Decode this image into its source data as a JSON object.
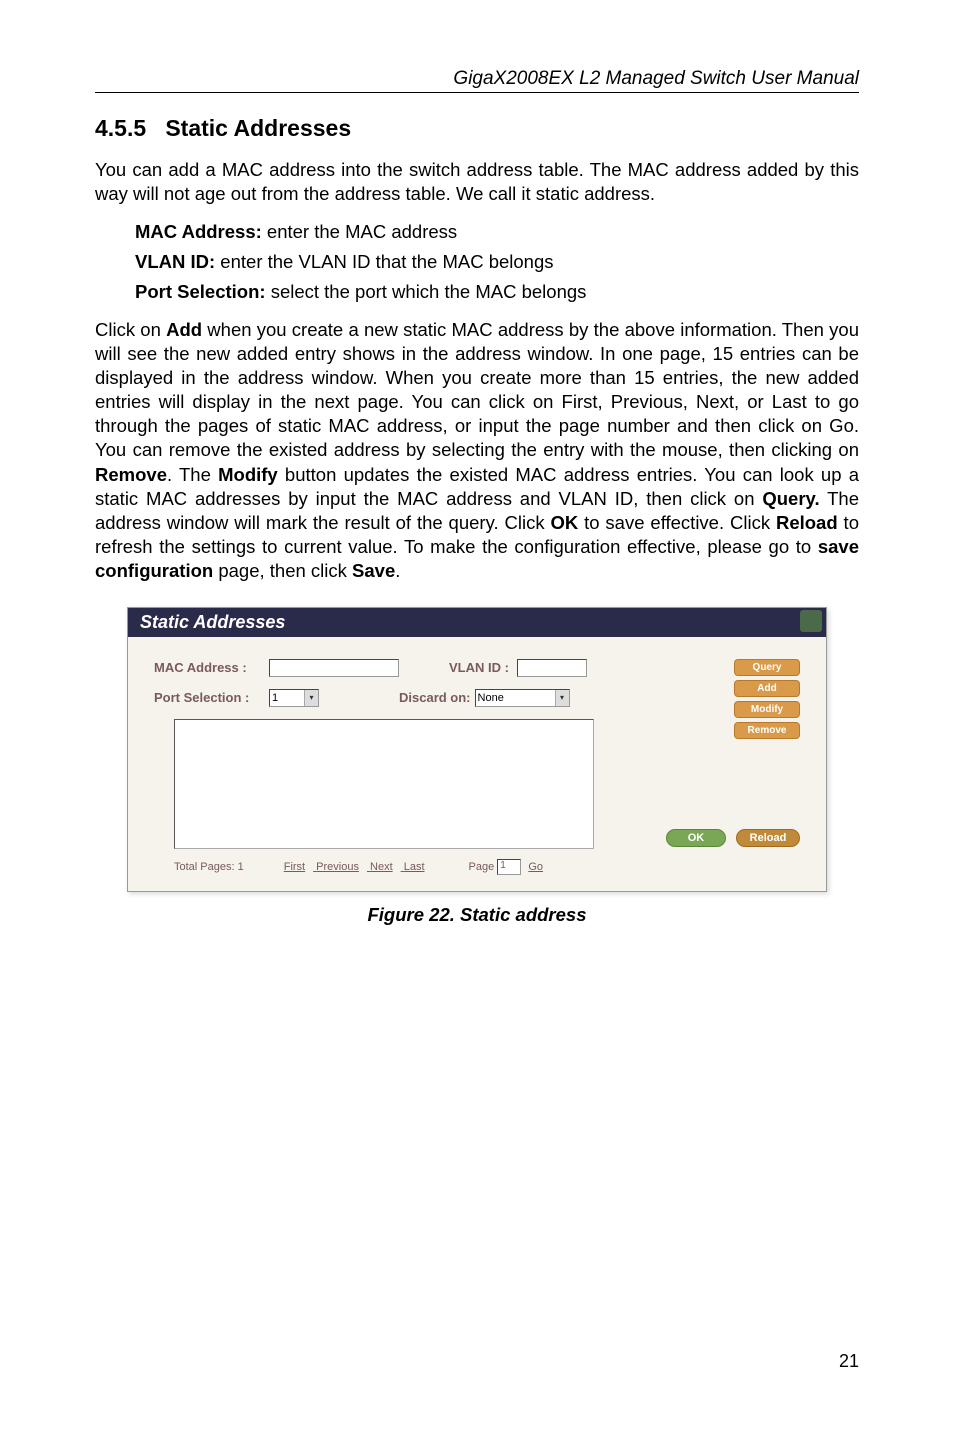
{
  "header": {
    "title": "GigaX2008EX L2 Managed Switch User Manual"
  },
  "section": {
    "number": "4.5.5",
    "title": "Static Addresses"
  },
  "para1": "You can add a MAC address into the switch address table. The MAC address added by this way will not age out from the address table. We call it static address.",
  "bullets": {
    "b1_label": "MAC Address:",
    "b1_text": " enter the MAC address",
    "b2_label": "VLAN ID:",
    "b2_text": " enter the VLAN ID that the MAC belongs",
    "b3_label": "Port Selection:",
    "b3_text": " select the port which the MAC belongs"
  },
  "para2_parts": {
    "p1": "Click on ",
    "b1": "Add",
    "p2": " when you create a new static MAC address by the above information. Then you will see the new added entry shows in the address window. In one page, 15 entries can be displayed in the address window. When you create more than 15 entries, the new added entries will display in the next page. You can click on First, Previous, Next, or Last to go through the pages of static MAC address, or input the page number and then click on Go. You can remove the existed address by selecting the entry with the mouse, then clicking on ",
    "b2": "Remove",
    "p3": ". The ",
    "b3": "Modify",
    "p4": " button updates the existed MAC address entries. You can look up a static MAC addresses by input the MAC address and VLAN ID, then click on ",
    "b4": "Query.",
    "p5": " The address window will mark the result of the query. Click ",
    "b5": "OK",
    "p6": " to save effective. Click ",
    "b6": "Reload",
    "p7": " to refresh the settings to current value. To make the configuration effective, please go to ",
    "b7": "save configuration",
    "p8": " page, then click ",
    "b8": "Save",
    "p9": "."
  },
  "figure": {
    "title": "Static Addresses",
    "mac_label": "MAC Address :",
    "vlan_label": "VLAN ID :",
    "port_label": "Port Selection :",
    "port_value": "1",
    "discard_label": "Discard on:",
    "discard_value": "None",
    "btn_query": "Query",
    "btn_add": "Add",
    "btn_modify": "Modify",
    "btn_remove": "Remove",
    "btn_ok": "OK",
    "btn_reload": "Reload",
    "total_label": "Total Pages: 1",
    "link_first": "First",
    "link_prev": "Previous",
    "link_next": "Next",
    "link_last": "Last",
    "page_label": "Page",
    "page_value": "1",
    "go_label": "Go",
    "caption": "Figure 22. Static address"
  },
  "footer": {
    "page": "21"
  }
}
